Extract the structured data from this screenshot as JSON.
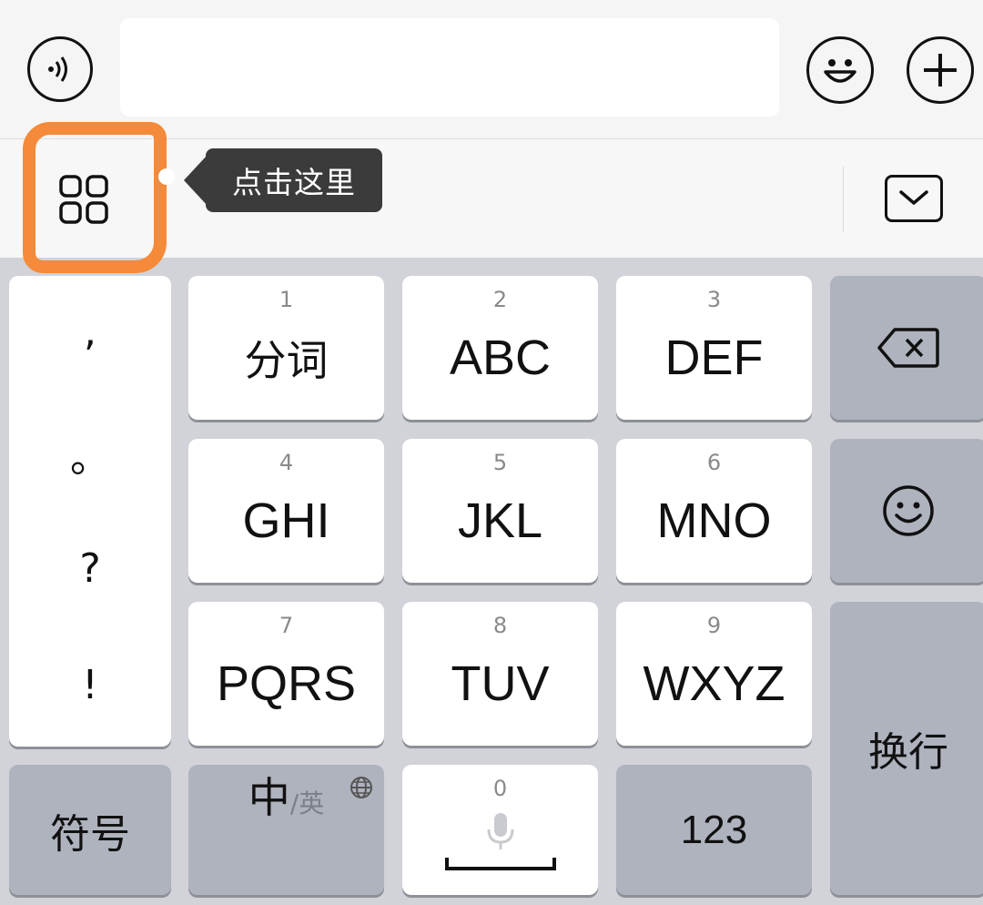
{
  "tooltip": {
    "text": "点击这里"
  },
  "punctuation": [
    ",",
    "。",
    "?",
    "!"
  ],
  "keys": {
    "k1": {
      "num": "1",
      "label": "分词"
    },
    "k2": {
      "num": "2",
      "label": "ABC"
    },
    "k3": {
      "num": "3",
      "label": "DEF"
    },
    "k4": {
      "num": "4",
      "label": "GHI"
    },
    "k5": {
      "num": "5",
      "label": "JKL"
    },
    "k6": {
      "num": "6",
      "label": "MNO"
    },
    "k7": {
      "num": "7",
      "label": "PQRS"
    },
    "k8": {
      "num": "8",
      "label": "TUV"
    },
    "k9": {
      "num": "9",
      "label": "WXYZ"
    },
    "k0": {
      "num": "0"
    }
  },
  "bottom": {
    "symbols": "符号",
    "lang_main": "中",
    "lang_alt": "/英",
    "numbers": "123",
    "enter": "换行"
  },
  "colors": {
    "highlight": "#f48a3a",
    "tooltip_bg": "#3b3b3b",
    "key_dark": "#aeb3be",
    "keyboard_bg": "#d1d3d9"
  }
}
